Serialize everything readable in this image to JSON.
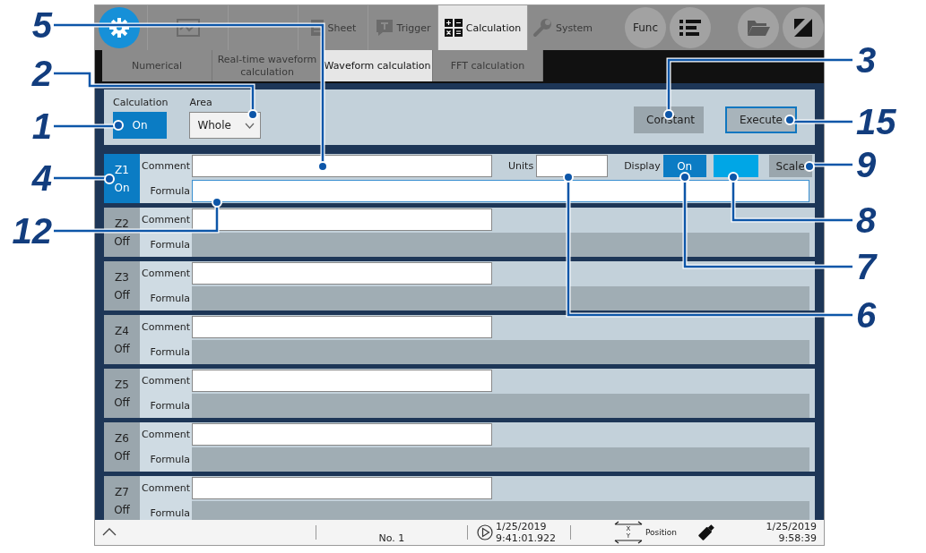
{
  "top_bar": {
    "tabs": [
      {
        "selected": false
      },
      {
        "selected": false
      },
      {
        "label": "Sheet",
        "selected": false
      },
      {
        "label": "Trigger",
        "selected": false
      },
      {
        "label": "Calculation",
        "selected": true
      },
      {
        "label": "System",
        "selected": false
      }
    ],
    "func_button": "Func"
  },
  "sub_tabs": [
    {
      "label": "Numerical",
      "selected": false
    },
    {
      "label": "Real-time waveform calculation",
      "selected": false
    },
    {
      "label": "Waveform calculation",
      "selected": true
    },
    {
      "label": "FFT calculation",
      "selected": false
    }
  ],
  "controls": {
    "calculation_label": "Calculation",
    "calculation_button": {
      "label": "On",
      "on": true
    },
    "area_label": "Area",
    "area_value": "Whole",
    "constant_button": "Constant",
    "execute_button": "Execute"
  },
  "rows": [
    {
      "name": "Z1",
      "state": "On",
      "on": true,
      "comment_label": "Comment",
      "formula_label": "Formula",
      "units_label": "Units",
      "display_label": "Display",
      "display_button": {
        "label": "On",
        "on": true
      },
      "color": "#00a6e6",
      "scale_button": "Scale"
    },
    {
      "name": "Z2",
      "state": "Off",
      "on": false,
      "comment_label": "Comment",
      "formula_label": "Formula"
    },
    {
      "name": "Z3",
      "state": "Off",
      "on": false,
      "comment_label": "Comment",
      "formula_label": "Formula"
    },
    {
      "name": "Z4",
      "state": "Off",
      "on": false,
      "comment_label": "Comment",
      "formula_label": "Formula"
    },
    {
      "name": "Z5",
      "state": "Off",
      "on": false,
      "comment_label": "Comment",
      "formula_label": "Formula"
    },
    {
      "name": "Z6",
      "state": "Off",
      "on": false,
      "comment_label": "Comment",
      "formula_label": "Formula"
    },
    {
      "name": "Z7",
      "state": "Off",
      "on": false,
      "comment_label": "Comment",
      "formula_label": "Formula"
    }
  ],
  "status_bar": {
    "number": "No. 1",
    "trigger_date": "1/25/2019",
    "trigger_time": "9:41:01.922",
    "axis_x": "X",
    "axis_y": "Y",
    "position_label": "Position",
    "date": "1/25/2019",
    "time": "9:58:39"
  },
  "callouts": [
    {
      "number": "5"
    },
    {
      "number": "2"
    },
    {
      "number": "1"
    },
    {
      "number": "4"
    },
    {
      "number": "12"
    },
    {
      "number": "3"
    },
    {
      "number": "15"
    },
    {
      "number": "9"
    },
    {
      "number": "8"
    },
    {
      "number": "7"
    },
    {
      "number": "6"
    }
  ]
}
